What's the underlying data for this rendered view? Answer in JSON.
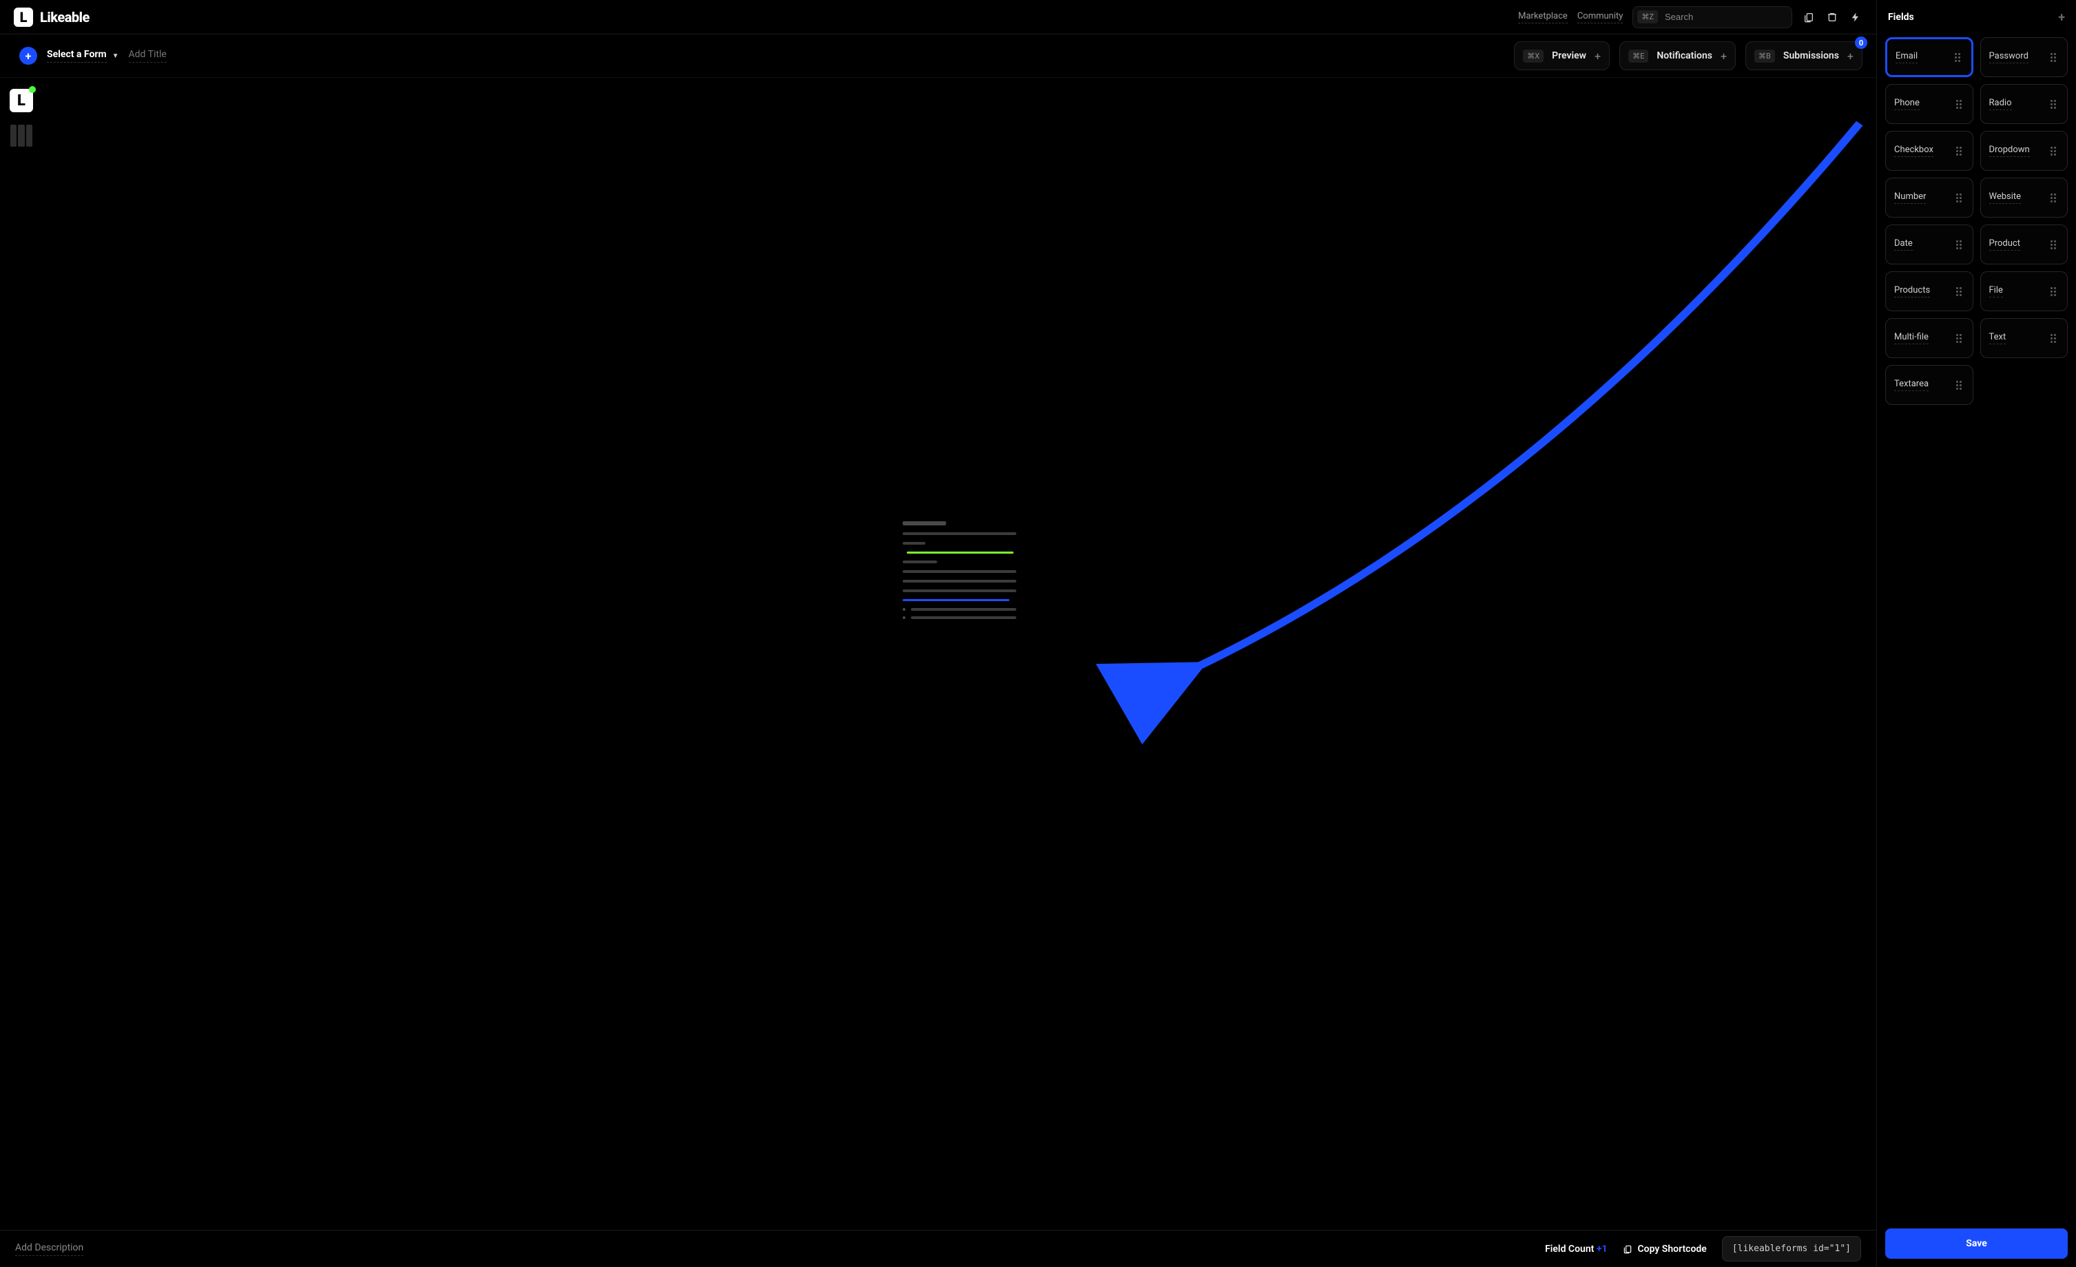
{
  "brand": "Likeable",
  "logo_letter": "L",
  "header": {
    "links": [
      "Marketplace",
      "Community"
    ],
    "search_kbd": "⌘Z",
    "search_placeholder": "Search"
  },
  "subheader": {
    "select_form_label": "Select a Form",
    "add_title_placeholder": "Add Title",
    "tabs": [
      {
        "kbd": "⌘X",
        "label": "Preview"
      },
      {
        "kbd": "⌘E",
        "label": "Notifications"
      },
      {
        "kbd": "⌘B",
        "label": "Submissions",
        "badge": "0"
      }
    ]
  },
  "footer": {
    "add_desc_placeholder": "Add Description",
    "field_count_label": "Field Count",
    "field_count_value": "+1",
    "copy_shortcode_label": "Copy Shortcode",
    "shortcode": "[likeableforms id=\"1\"]"
  },
  "right": {
    "title": "Fields",
    "save_label": "Save",
    "fields": [
      {
        "name": "Email",
        "selected": true
      },
      {
        "name": "Password"
      },
      {
        "name": "Phone"
      },
      {
        "name": "Radio"
      },
      {
        "name": "Checkbox"
      },
      {
        "name": "Dropdown"
      },
      {
        "name": "Number"
      },
      {
        "name": "Website"
      },
      {
        "name": "Date"
      },
      {
        "name": "Product"
      },
      {
        "name": "Products"
      },
      {
        "name": "File"
      },
      {
        "name": "Multi-file"
      },
      {
        "name": "Text"
      },
      {
        "name": "Textarea"
      }
    ]
  }
}
